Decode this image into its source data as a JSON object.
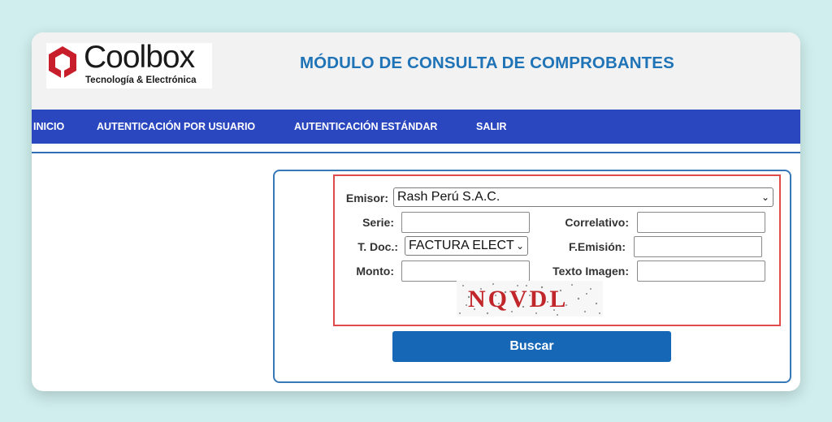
{
  "logo": {
    "brand": "Coolbox",
    "tagline": "Tecnología & Electrónica"
  },
  "page_title": "MÓDULO DE CONSULTA DE COMPROBANTES",
  "nav": {
    "items": [
      {
        "label": "INICIO"
      },
      {
        "label": "AUTENTICACIÓN POR USUARIO"
      },
      {
        "label": "AUTENTICACIÓN ESTÁNDAR"
      },
      {
        "label": "SALIR"
      }
    ]
  },
  "form": {
    "emisor": {
      "label": "Emisor:",
      "value": "Rash Perú S.A.C."
    },
    "serie": {
      "label": "Serie:",
      "value": ""
    },
    "correlativo": {
      "label": "Correlativo:",
      "value": ""
    },
    "tdoc": {
      "label": "T. Doc.:",
      "value": "FACTURA ELECT"
    },
    "femision": {
      "label": "F.Emisión:",
      "value": ""
    },
    "monto": {
      "label": "Monto:",
      "value": ""
    },
    "texto_imagen": {
      "label": "Texto Imagen:",
      "value": ""
    },
    "captcha_text": "NQVDL"
  },
  "buscar_label": "Buscar",
  "colors": {
    "background": "#cfeeed",
    "title": "#1f73b7",
    "navbar": "#2b47c0",
    "button": "#1767b7",
    "highlight_box": "#e04a4a",
    "captcha": "#c0262a"
  },
  "icons": {
    "logo_mark": "coolbox-hexagon-logo-icon",
    "select_arrow": "chevron-down-icon"
  }
}
